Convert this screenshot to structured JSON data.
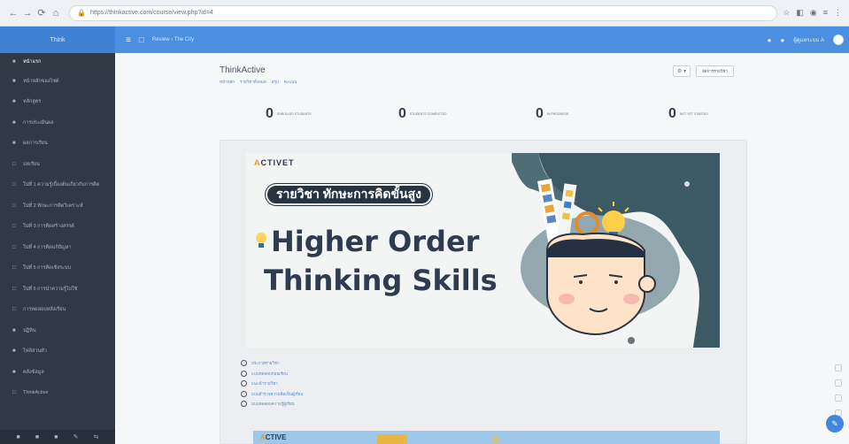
{
  "browser": {
    "url": "https://thinkactive.com/course/view.php?id=4",
    "nav": [
      "←",
      "→",
      "⟳",
      "⌂"
    ],
    "icons": [
      "star-icon",
      "extension-icon",
      "profile-icon",
      "menu-icon",
      "kebab-icon"
    ]
  },
  "topbar": {
    "brand": "Think",
    "crumb_text": "Review › The City",
    "user_name": "ผู้ดูแลระบบ A"
  },
  "sidebar": {
    "items": [
      {
        "icon": "■",
        "label": "หน้าแรก"
      },
      {
        "icon": "■",
        "label": "หน้าหลักของไซต์"
      },
      {
        "icon": "■",
        "label": "หลักสูตร"
      },
      {
        "icon": "■",
        "label": "การประเมินผล"
      },
      {
        "icon": "■",
        "label": "ผลการเรียน"
      },
      {
        "icon": "□",
        "label": "บทเรียน"
      },
      {
        "icon": "□",
        "label": "ใน่ที่ 1 ความรู้เบื้องต้นเกี่ยวกับการคิด"
      },
      {
        "icon": "□",
        "label": "ใน่ที่ 2 ทักษะการคิดวิเคราะห์"
      },
      {
        "icon": "□",
        "label": "ใน่ที่ 3 การคิดสร้างสรรค์"
      },
      {
        "icon": "□",
        "label": "ใน่ที่ 4 การคิดแก้ปัญหา"
      },
      {
        "icon": "□",
        "label": "ใน่ที่ 5 การคิดเชิงระบบ"
      },
      {
        "icon": "□",
        "label": "ใน่ที่ 6 การนำความรู้ไปใช้"
      },
      {
        "icon": "□",
        "label": "การทดสอบหลังเรียน"
      },
      {
        "icon": "■",
        "label": "ปฏิทิน"
      },
      {
        "icon": "■",
        "label": "ไฟล์ส่วนตัว"
      },
      {
        "icon": "■",
        "label": "คลังข้อมูล"
      },
      {
        "icon": "□",
        "label": "ThinkActive"
      }
    ],
    "footer_icons": [
      "■",
      "■",
      "■",
      "✎",
      "⇆"
    ]
  },
  "course": {
    "title": "ThinkActive",
    "subnav": [
      "หน้าหลัก",
      "รายวิชาทั้งหมด",
      "สรุป",
      "คะแนน"
    ],
    "gear_label": "⚙ ▾",
    "action_label": "จัดการรายวิชา"
  },
  "stats": [
    {
      "num": "0",
      "label": "ENROLLED STUDENTS"
    },
    {
      "num": "0",
      "label": "STUDENTS COMPLETED"
    },
    {
      "num": "0",
      "label": "IN PROGRESS"
    },
    {
      "num": "0",
      "label": "NOT YET STARTED"
    }
  ],
  "banner": {
    "brand_a": "A",
    "brand_rest": "CTIVET",
    "thai_title": "รายวิชา ทักษะการคิดขั้นสูง",
    "headline_1": "Higher Order",
    "headline_2": "Thinking Skills"
  },
  "links": [
    "ประกาศรายวิชา",
    "แบบทดสอบก่อนเรียน",
    "แนะนำรายวิชา",
    "แบบสำรวจความคิดเห็นผู้เรียน",
    "แบบทดสอบความรู้ผู้เรียน"
  ],
  "banner2": {
    "brand_a": "A",
    "brand_rest": "CTIVE"
  },
  "fab_label": "✎",
  "colors": {
    "topbar": "#4a8fe0",
    "sidebar": "#303a46",
    "accent_orange": "#e99a2a",
    "art_teal": "#3c5a63"
  }
}
